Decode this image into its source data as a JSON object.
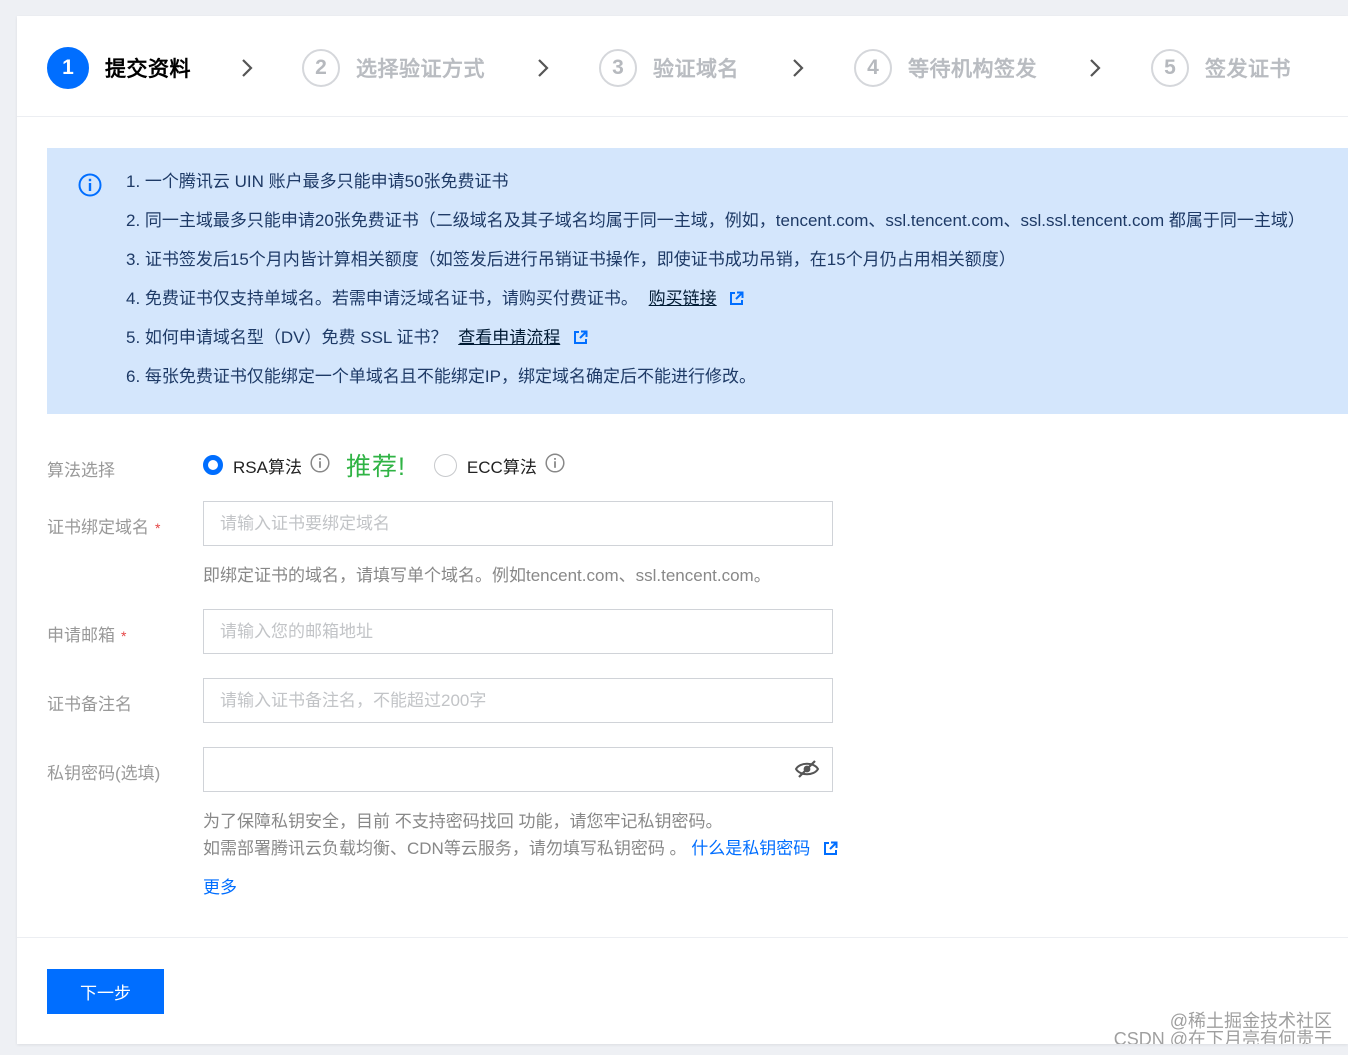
{
  "steps": [
    {
      "num": "1",
      "label": "提交资料"
    },
    {
      "num": "2",
      "label": "选择验证方式"
    },
    {
      "num": "3",
      "label": "验证域名"
    },
    {
      "num": "4",
      "label": "等待机构签发"
    },
    {
      "num": "5",
      "label": "签发证书"
    }
  ],
  "notice": {
    "items": [
      "1. 一个腾讯云 UIN 账户最多只能申请50张免费证书",
      "2. 同一主域最多只能申请20张免费证书（二级域名及其子域名均属于同一主域，例如，tencent.com、ssl.tencent.com、ssl.ssl.tencent.com 都属于同一主域）",
      "3. 证书签发后15个月内皆计算相关额度（如签发后进行吊销证书操作，即使证书成功吊销，在15个月仍占用相关额度）",
      "4. 免费证书仅支持单域名。若需申请泛域名证书，请购买付费证书。",
      "5. 如何申请域名型（DV）免费 SSL 证书？",
      "6. 每张免费证书仅能绑定一个单域名且不能绑定IP，绑定域名确定后不能进行修改。"
    ],
    "buy_link": "购买链接",
    "flow_link": "查看申请流程"
  },
  "form": {
    "algo_label": "算法选择",
    "rsa_label": "RSA算法",
    "recommend": "推荐!",
    "ecc_label": "ECC算法",
    "domain_label": "证书绑定域名",
    "domain_placeholder": "请输入证书要绑定域名",
    "domain_help": "即绑定证书的域名，请填写单个域名。例如tencent.com、ssl.tencent.com。",
    "email_label": "申请邮箱",
    "email_placeholder": "请输入您的邮箱地址",
    "remark_label": "证书备注名",
    "remark_placeholder": "请输入证书备注名，不能超过200字",
    "key_label": "私钥密码(选填)",
    "key_help_1": "为了保障私钥安全，目前 不支持密码找回 功能，请您牢记私钥密码。",
    "key_help_2": "如需部署腾讯云负载均衡、CDN等云服务，请勿填写私钥密码 。",
    "key_help_link": "什么是私钥密码",
    "more": "更多",
    "required_mark": "*"
  },
  "next_button": "下一步",
  "watermark": {
    "line1": "@稀土掘金技术社区",
    "line2": "CSDN @在下月亮有何贵干"
  },
  "colors": {
    "primary": "#006eff",
    "notice_bg": "#d4e6fc",
    "recommend": "#2fb344"
  }
}
